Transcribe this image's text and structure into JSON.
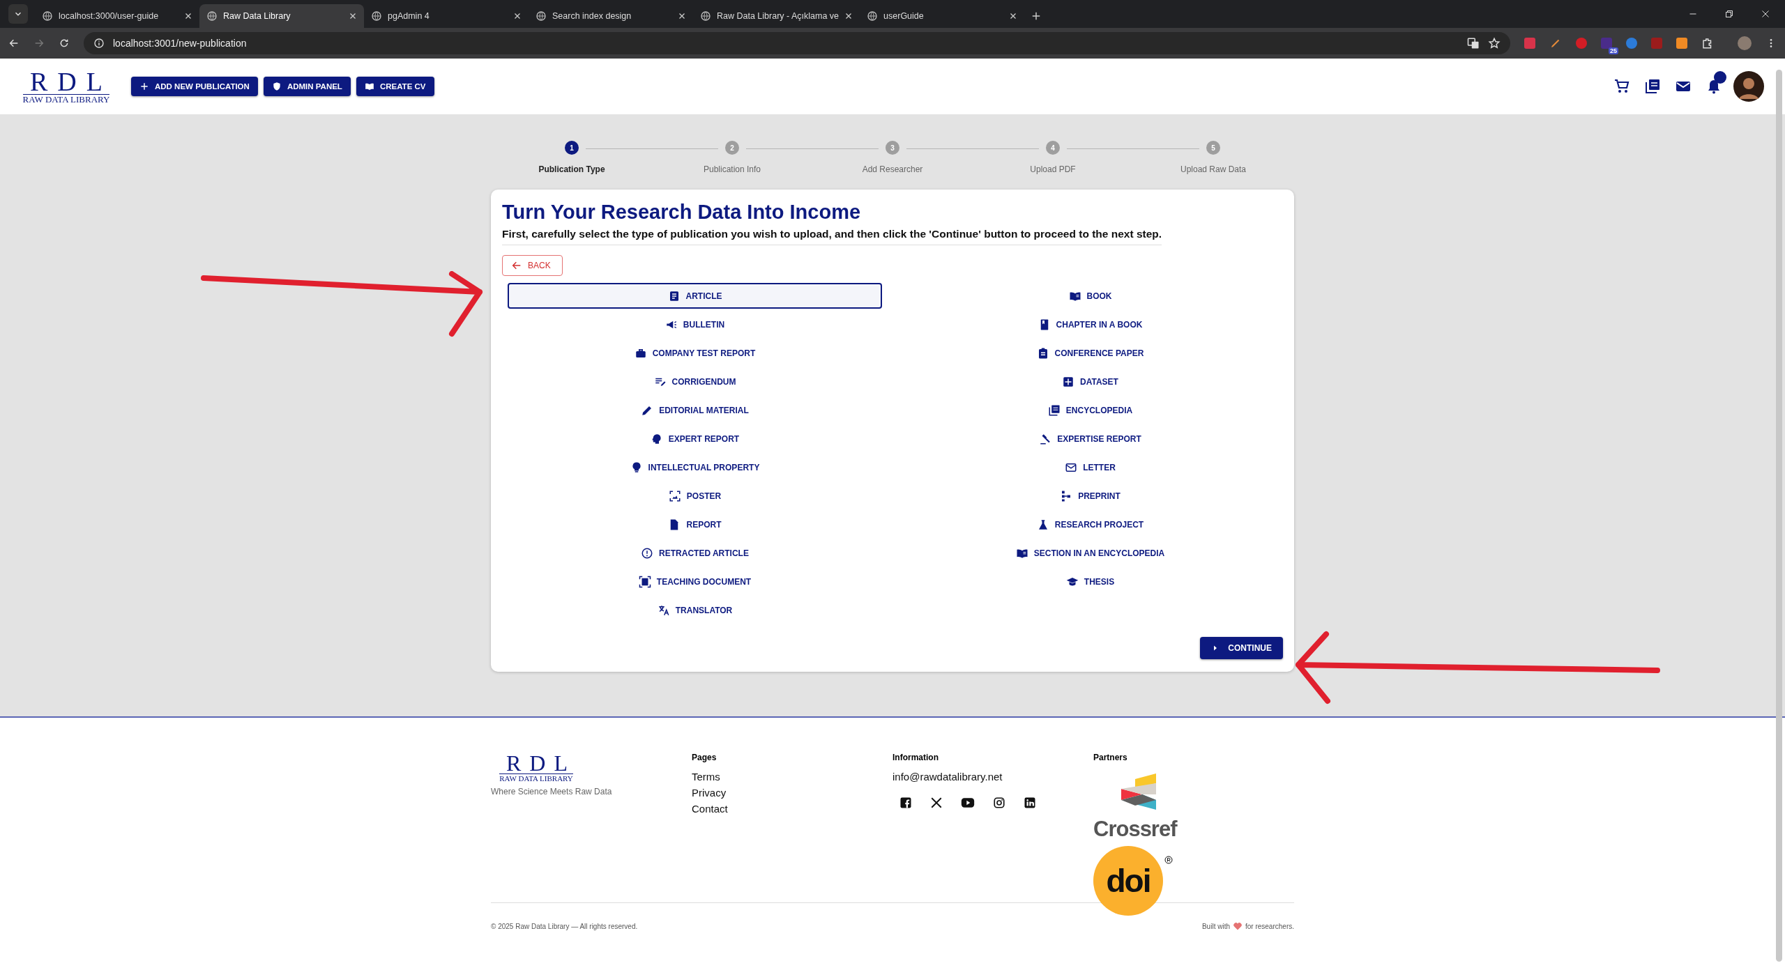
{
  "browser": {
    "tabs": [
      {
        "title": "localhost:3000/user-guide",
        "selected": false
      },
      {
        "title": "Raw Data Library",
        "selected": true
      },
      {
        "title": "pgAdmin 4",
        "selected": false
      },
      {
        "title": "Search index design",
        "selected": false
      },
      {
        "title": "Raw Data Library - Açıklama ve",
        "selected": false
      },
      {
        "title": "userGuide",
        "selected": false
      }
    ],
    "url": "localhost:3001/new-publication",
    "extension_badge": "25"
  },
  "header": {
    "logo": {
      "letters": "RDL",
      "name": "RAW DATA LIBRARY"
    },
    "buttons": [
      "ADD NEW PUBLICATION",
      "ADMIN PANEL",
      "CREATE CV"
    ],
    "notifications_dot": true
  },
  "steps": [
    {
      "number": "1",
      "label": "Publication Type",
      "selected": true
    },
    {
      "number": "2",
      "label": "Publication Info",
      "selected": false
    },
    {
      "number": "3",
      "label": "Add Researcher",
      "selected": false
    },
    {
      "number": "4",
      "label": "Upload PDF",
      "selected": false
    },
    {
      "number": "5",
      "label": "Upload Raw Data",
      "selected": false
    }
  ],
  "card": {
    "title": "Turn Your Research Data Into Income",
    "subtitle": "First, carefully select the type of publication you wish to upload, and then click the 'Continue' button to proceed to the next step.",
    "back_button": "BACK",
    "continue_button": "CONTINUE"
  },
  "publication_types": {
    "left": [
      {
        "label": "ARTICLE",
        "selected": true
      },
      {
        "label": "BULLETIN",
        "selected": false
      },
      {
        "label": "COMPANY TEST REPORT",
        "selected": false
      },
      {
        "label": "CORRIGENDUM",
        "selected": false
      },
      {
        "label": "EDITORIAL MATERIAL",
        "selected": false
      },
      {
        "label": "EXPERT REPORT",
        "selected": false
      },
      {
        "label": "INTELLECTUAL PROPERTY",
        "selected": false
      },
      {
        "label": "POSTER",
        "selected": false
      },
      {
        "label": "REPORT",
        "selected": false
      },
      {
        "label": "RETRACTED ARTICLE",
        "selected": false
      },
      {
        "label": "TEACHING DOCUMENT",
        "selected": false
      },
      {
        "label": "TRANSLATOR",
        "selected": false
      }
    ],
    "right": [
      {
        "label": "BOOK",
        "selected": false
      },
      {
        "label": "CHAPTER IN A BOOK",
        "selected": false
      },
      {
        "label": "CONFERENCE PAPER",
        "selected": false
      },
      {
        "label": "DATASET",
        "selected": false
      },
      {
        "label": "ENCYCLOPEDIA",
        "selected": false
      },
      {
        "label": "EXPERTISE REPORT",
        "selected": false
      },
      {
        "label": "LETTER",
        "selected": false
      },
      {
        "label": "PREPRINT",
        "selected": false
      },
      {
        "label": "RESEARCH PROJECT",
        "selected": false
      },
      {
        "label": "SECTION IN AN ENCYCLOPEDIA",
        "selected": false
      },
      {
        "label": "THESIS",
        "selected": false
      }
    ]
  },
  "footer": {
    "logo": {
      "letters": "RDL",
      "name": "RAW DATA LIBRARY"
    },
    "tagline": "Where Science Meets Raw Data",
    "pages": {
      "heading": "Pages",
      "links": [
        "Terms",
        "Privacy",
        "Contact"
      ]
    },
    "information": {
      "heading": "Information",
      "email": "info@rawdatalibrary.net"
    },
    "partners": {
      "heading": "Partners",
      "logos": [
        "Crossref",
        "doi"
      ]
    },
    "copyright": "© 2025 Raw Data Library — All rights reserved.",
    "built_with": {
      "before": "Built with",
      "after": "for researchers."
    }
  }
}
